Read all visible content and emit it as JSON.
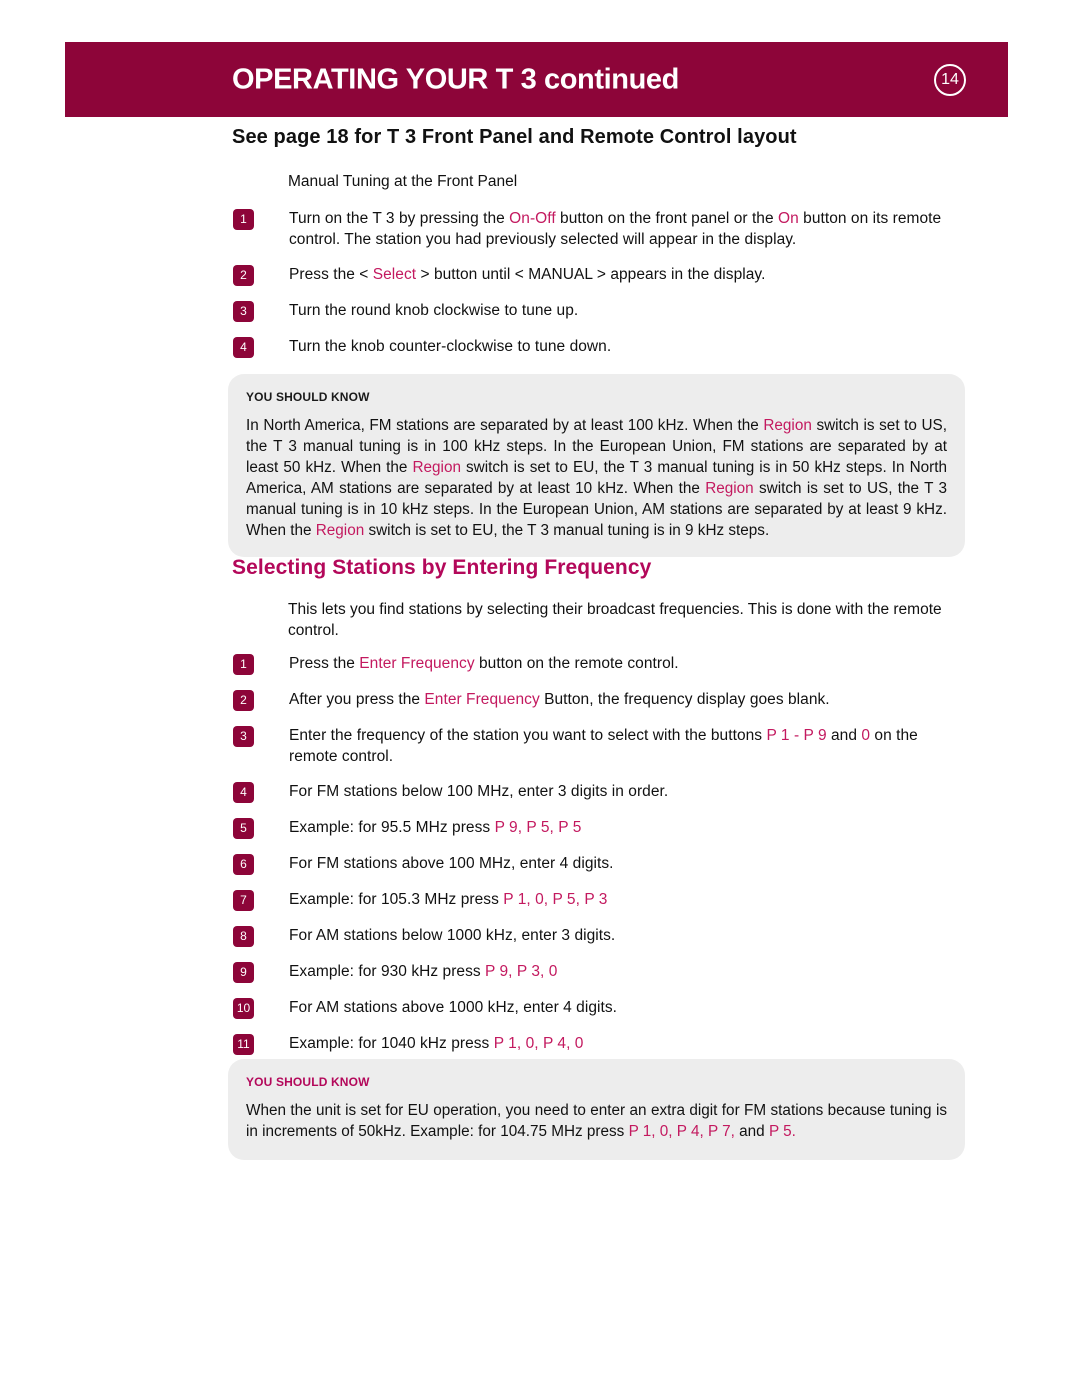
{
  "header": {
    "title": "OPERATING YOUR T 3 continued",
    "page_number": "14",
    "bar_color": "#8d0539"
  },
  "subhead": "See page 18 for T 3 Front Panel and Remote Control layout",
  "section1": {
    "minor_heading": "Manual Tuning at the Front Panel",
    "steps": [
      {
        "num": "1",
        "parts": [
          {
            "t": "Turn on the T 3 by pressing the ",
            "hl": false
          },
          {
            "t": "On-Off",
            "hl": true
          },
          {
            "t": " button on the front panel or the ",
            "hl": false
          },
          {
            "t": "On",
            "hl": true
          },
          {
            "t": " button on its remote control. The station you had previously selected will appear in the display.",
            "hl": false
          }
        ]
      },
      {
        "num": "2",
        "parts": [
          {
            "t": "Press the < ",
            "hl": false
          },
          {
            "t": "Select",
            "hl": true
          },
          {
            "t": " > button until < MANUAL > appears in the display.",
            "hl": false
          }
        ]
      },
      {
        "num": "3",
        "parts": [
          {
            "t": "Turn the round knob clockwise to tune up.",
            "hl": false
          }
        ]
      },
      {
        "num": "4",
        "parts": [
          {
            "t": "Turn the knob counter-clockwise to tune down.",
            "hl": false
          }
        ]
      }
    ]
  },
  "note1": {
    "heading": "YOU SHOULD KNOW",
    "heading_color": "#1a1a1a",
    "parts": [
      {
        "t": "In North America, FM stations are separated by at least 100 kHz. When the ",
        "hl": false
      },
      {
        "t": "Region",
        "hl": true
      },
      {
        "t": " switch is set to US, the T 3 manual tuning is in 100 kHz steps. In the European Union, FM stations are separated by at least 50 kHz. When the ",
        "hl": false
      },
      {
        "t": "Region",
        "hl": true
      },
      {
        "t": " switch is set to EU, the T 3 manual tuning is in 50 kHz steps. In North America, AM stations are separated by at least 10 kHz. When the ",
        "hl": false
      },
      {
        "t": "Region",
        "hl": true
      },
      {
        "t": " switch is set to US, the T 3 manual tuning is in 10 kHz steps. In the European Union, AM stations are separated by at least 9 kHz. When the ",
        "hl": false
      },
      {
        "t": "Region",
        "hl": true
      },
      {
        "t": " switch is set to EU, the T 3 manual tuning is in 9 kHz steps.",
        "hl": false
      }
    ]
  },
  "section2": {
    "title": "Selecting Stations by Entering Frequency",
    "intro": "This lets you find stations by selecting their broadcast frequencies. This is done with the remote control.",
    "steps": [
      {
        "num": "1",
        "parts": [
          {
            "t": "Press the ",
            "hl": false
          },
          {
            "t": "Enter Frequency",
            "hl": true
          },
          {
            "t": " button on the remote control.",
            "hl": false
          }
        ]
      },
      {
        "num": "2",
        "parts": [
          {
            "t": "After you press the ",
            "hl": false
          },
          {
            "t": "Enter Frequency",
            "hl": true
          },
          {
            "t": " Button, the frequency display goes blank.",
            "hl": false
          }
        ]
      },
      {
        "num": "3",
        "parts": [
          {
            "t": "Enter the frequency of the station you want to select with the buttons ",
            "hl": false
          },
          {
            "t": "P 1 - P 9",
            "hl": true
          },
          {
            "t": " and ",
            "hl": false
          },
          {
            "t": "0",
            "hl": true
          },
          {
            "t": " on the remote control.",
            "hl": false
          }
        ]
      },
      {
        "num": "4",
        "parts": [
          {
            "t": "For FM stations below 100 MHz, enter 3 digits in order.",
            "hl": false
          }
        ]
      },
      {
        "num": "5",
        "parts": [
          {
            "t": "Example: for 95.5 MHz press ",
            "hl": false
          },
          {
            "t": "P 9, P 5, P 5",
            "hl": true
          }
        ]
      },
      {
        "num": "6",
        "parts": [
          {
            "t": "For FM stations above 100 MHz, enter 4 digits.",
            "hl": false
          }
        ]
      },
      {
        "num": "7",
        "parts": [
          {
            "t": "Example: for 105.3 MHz press ",
            "hl": false
          },
          {
            "t": "P 1, 0, P 5, P 3",
            "hl": true
          }
        ]
      },
      {
        "num": "8",
        "parts": [
          {
            "t": "For AM stations below 1000 kHz, enter 3 digits.",
            "hl": false
          }
        ]
      },
      {
        "num": "9",
        "parts": [
          {
            "t": "Example: for 930 kHz press ",
            "hl": false
          },
          {
            "t": "P 9, P 3, 0",
            "hl": true
          }
        ]
      },
      {
        "num": "10",
        "parts": [
          {
            "t": "For AM stations above 1000 kHz, enter 4 digits.",
            "hl": false
          }
        ]
      },
      {
        "num": "11",
        "parts": [
          {
            "t": "Example: for 1040 kHz press ",
            "hl": false
          },
          {
            "t": "P 1, 0, P 4, 0",
            "hl": true
          }
        ]
      }
    ]
  },
  "note2": {
    "heading": "YOU SHOULD KNOW",
    "heading_color": "#b3085a",
    "parts": [
      {
        "t": "When the unit is set for EU operation, you need to enter an extra digit for FM stations because tuning is in increments of 50kHz. Example: for 104.75 MHz press ",
        "hl": false
      },
      {
        "t": "P 1, 0, P 4, P 7,",
        "hl": true
      },
      {
        "t": " and ",
        "hl": false
      },
      {
        "t": "P 5.",
        "hl": true
      }
    ]
  }
}
